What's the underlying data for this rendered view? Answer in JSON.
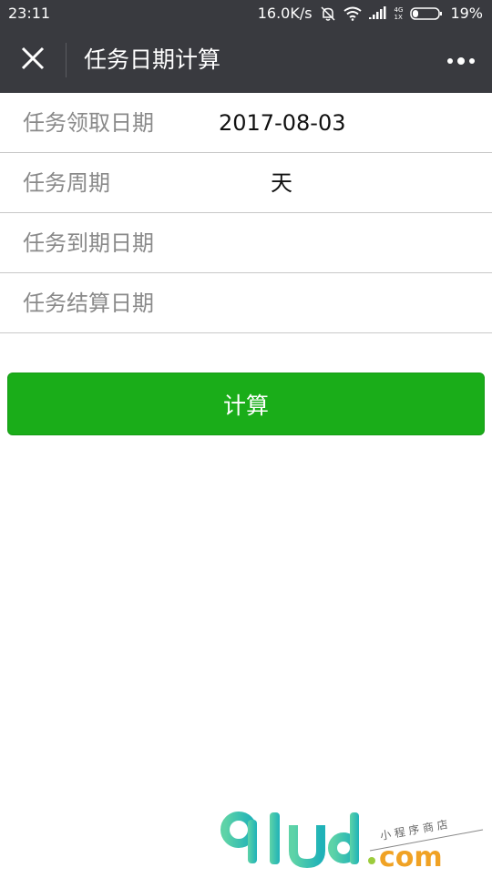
{
  "status_bar": {
    "time": "23:11",
    "net_speed": "16.0K/s",
    "net_type_top": "4G",
    "net_type_bottom": "1X",
    "battery": "19%",
    "icons": [
      "mute-bell-icon",
      "wifi-icon",
      "signal-icon",
      "battery-icon"
    ]
  },
  "nav": {
    "title": "任务日期计算",
    "close_icon": "close-icon",
    "more_icon": "more-icon"
  },
  "form": {
    "rows": [
      {
        "label": "任务领取日期",
        "value": "2017-08-03"
      },
      {
        "label": "任务周期",
        "unit": "天",
        "value": ""
      },
      {
        "label": "任务到期日期",
        "value": ""
      },
      {
        "label": "任务结算日期",
        "value": ""
      }
    ]
  },
  "button": {
    "label": "计算",
    "color": "#1aad19"
  },
  "watermark": {
    "logo_text": "91ud",
    "domain_text": ".com",
    "tagline": "小程序商店"
  },
  "colors": {
    "header_bg": "#393a3f",
    "accent": "#1aad19"
  }
}
